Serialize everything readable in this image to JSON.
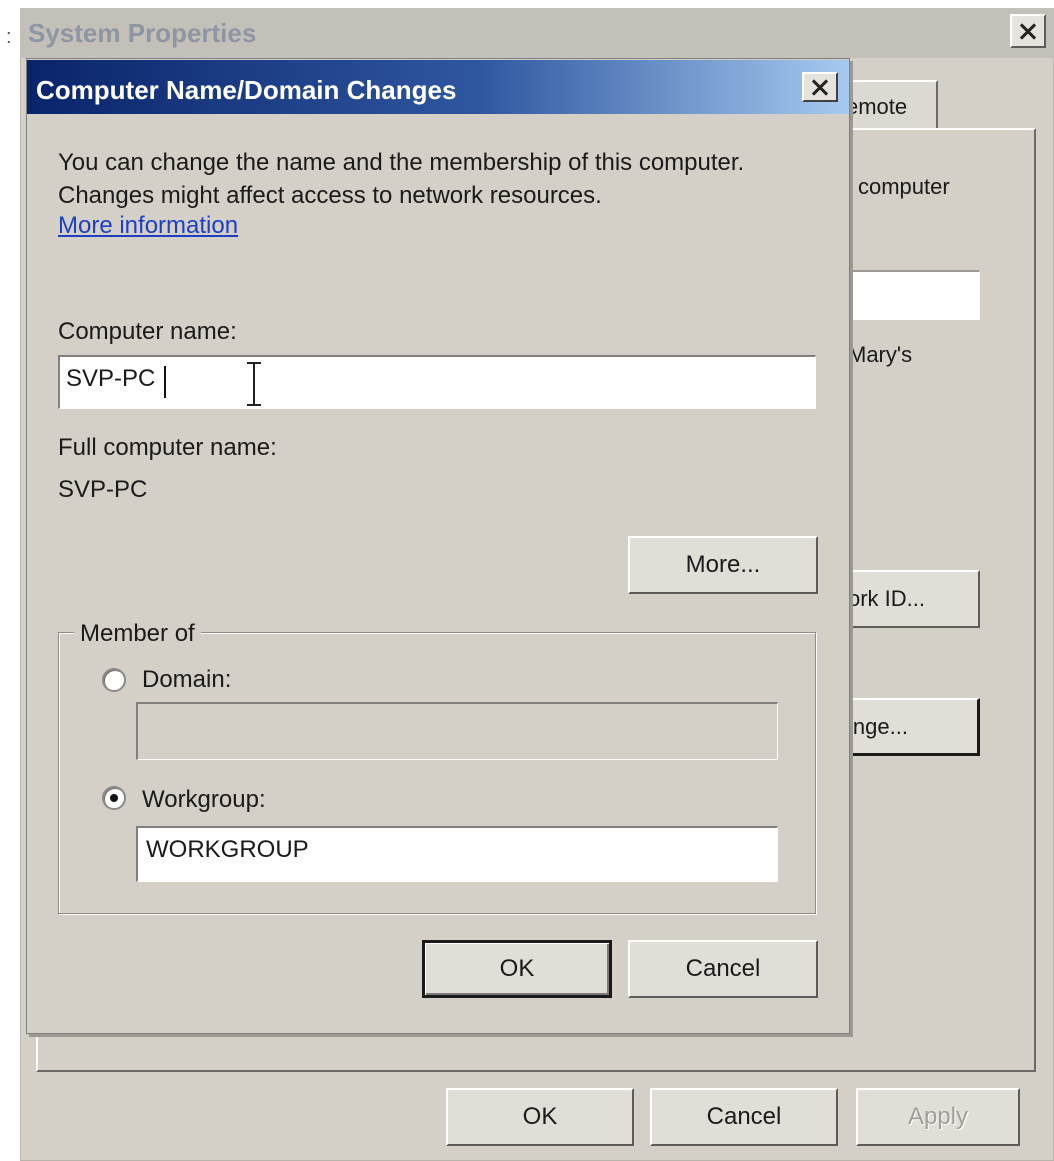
{
  "system_properties": {
    "title": "System Properties",
    "tab_fragment": "emote",
    "description_fragment": "computer",
    "text_fragment": "Mary's",
    "network_id_button_fragment": "ork ID...",
    "change_button_fragment": "inge...",
    "buttons": {
      "ok": "OK",
      "cancel": "Cancel",
      "apply": "Apply"
    }
  },
  "dialog": {
    "title": "Computer Name/Domain Changes",
    "description": "You can change the name and the membership of this computer. Changes might affect access to network resources.",
    "more_info_link": "More information",
    "computer_name": {
      "label": "Computer name:",
      "value": "SVP-PC"
    },
    "full_computer_name": {
      "label": "Full computer name:",
      "value": "SVP-PC"
    },
    "more_button": "More...",
    "member_of": {
      "legend": "Member of",
      "domain": {
        "label": "Domain:",
        "value": "",
        "selected": false
      },
      "workgroup": {
        "label": "Workgroup:",
        "value": "WORKGROUP",
        "selected": true
      }
    },
    "buttons": {
      "ok": "OK",
      "cancel": "Cancel"
    }
  },
  "colors": {
    "dialog_titlebar_start": "#0a246a",
    "dialog_titlebar_end": "#a6caf0",
    "window_face": "#d4d0c8",
    "link": "#1c3fc4"
  },
  "icons": {
    "close": "close-icon",
    "text_cursor": "ibeam-cursor-icon"
  }
}
